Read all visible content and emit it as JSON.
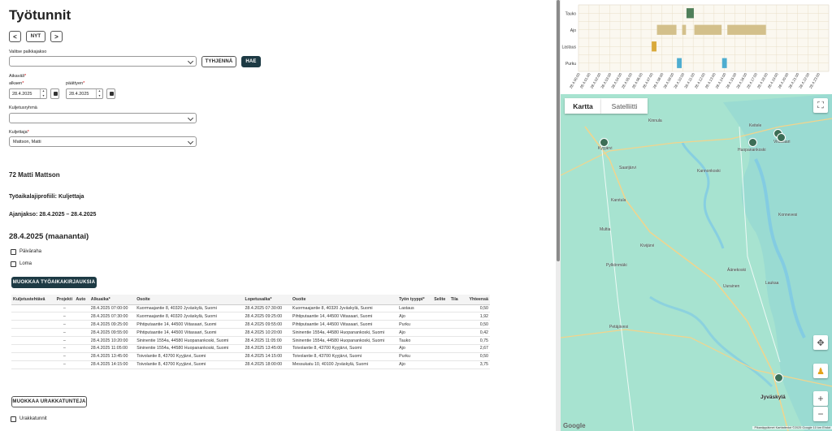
{
  "page": {
    "title": "Työtunnit",
    "prev_label": "<",
    "now_label": "NYT",
    "next_label": ">"
  },
  "filters": {
    "period_label": "Valitse palkkajakso",
    "period_value": "",
    "clear_label": "TYHJENNÄ",
    "fetch_label": "HAE",
    "range_label": "Aikaväli",
    "start_label": "alkaen",
    "start_value": "28.4.2025",
    "end_label": "päättyen",
    "end_value": "28.4.2025",
    "group_label": "Kuljetusryhmä",
    "group_value": "",
    "driver_label": "Kuljettaja",
    "driver_value": "Mattson, Matti",
    "required_mark": "*"
  },
  "summary": {
    "driver_heading": "72 Matti Mattson",
    "profile": "Työaikalajiprofiili: Kuljettaja",
    "period": "Ajanjakso: 28.4.2025 – 28.4.2025",
    "day_heading": "28.4.2025 (maanantai)",
    "allowance_label": "Päiväraha",
    "holiday_label": "Loma",
    "edit_log_label": "MUOKKAA TYÖAIKAKIRJAUKSIA",
    "edit_contracts_label": "MUOKKAA URAKKATUNTEJA",
    "contract_hours_label": "Urakkatunnit"
  },
  "table": {
    "headers": [
      "Kuljetustehtävä",
      "Projekti",
      "Auto",
      "Alkuaika*",
      "Osoite",
      "Lopetusaika*",
      "Osoite",
      "Työn tyyppi*",
      "Selite",
      "Tila",
      "Yhteensä"
    ],
    "rows": [
      [
        "",
        "–",
        "",
        "28.4.2025 07:00:00",
        "Kuormaajantie 8, 40320 Jyväskylä, Suomi",
        "28.4.2025 07:30:00",
        "Kuormaajantie 8, 40320 Jyväskylä, Suomi",
        "Lastaus",
        "",
        "",
        "0,50"
      ],
      [
        "",
        "–",
        "",
        "28.4.2025 07:30:00",
        "Kuormaajantie 8, 40320 Jyväskylä, Suomi",
        "28.4.2025 09:25:00",
        "Pihtiputaantie 14, 44500 Viitasaari, Suomi",
        "Ajo",
        "",
        "",
        "1,92"
      ],
      [
        "",
        "–",
        "",
        "28.4.2025 09:25:00",
        "Pihtiputaantie 14, 44500 Viitasaari, Suomi",
        "28.4.2025 09:55:00",
        "Pihtiputaantie 14, 44500 Viitasaari, Suomi",
        "Purku",
        "",
        "",
        "0,50"
      ],
      [
        "",
        "–",
        "",
        "28.4.2025 09:55:00",
        "Pihtiputaantie 14, 44500 Viitasaari, Suomi",
        "28.4.2025 10:20:00",
        "Sininentie 1554a, 44580 Huopanankoski, Suomi",
        "Ajo",
        "",
        "",
        "0,42"
      ],
      [
        "",
        "–",
        "",
        "28.4.2025 10:20:00",
        "Sininentie 1554a, 44580 Huopanankoski, Suomi",
        "28.4.2025 11:05:00",
        "Sininentie 1554a, 44580 Huopanankoski, Suomi",
        "Tauko",
        "",
        "",
        "0,75"
      ],
      [
        "",
        "–",
        "",
        "28.4.2025 11:05:00",
        "Sininentie 1554a, 44580 Huopanankoski, Suomi",
        "28.4.2025 13:45:00",
        "Toivolantie 8, 43700 Kyyjärvi, Suomi",
        "Ajo",
        "",
        "",
        "2,67"
      ],
      [
        "",
        "–",
        "",
        "28.4.2025 13:45:00",
        "Toivolantie 8, 43700 Kyyjärvi, Suomi",
        "28.4.2025 14:15:00",
        "Toivolantie 8, 43700 Kyyjärvi, Suomi",
        "Purku",
        "",
        "",
        "0,50"
      ],
      [
        "",
        "–",
        "",
        "28.4.2025 14:15:00",
        "Toivolantie 8, 43700 Kyyjärvi, Suomi",
        "28.4.2025 18:00:00",
        "Messukatu 10, 40100 Jyväskylä, Suomi",
        "Ajo",
        "",
        "",
        "3,75"
      ]
    ]
  },
  "chart_data": {
    "type": "timeline",
    "categories": [
      "Tauko",
      "Ajo",
      "Lastaus",
      "Purku"
    ],
    "x_ticks": [
      "28.4.00:00",
      "28.4.01:00",
      "28.4.02:00",
      "28.4.03:00",
      "28.4.04:00",
      "28.4.05:00",
      "28.4.06:00",
      "28.4.07:00",
      "28.4.08:00",
      "28.4.09:00",
      "28.4.10:00",
      "28.4.11:00",
      "28.4.12:00",
      "28.4.13:00",
      "28.4.14:00",
      "28.4.15:00",
      "28.4.16:00",
      "28.4.17:00",
      "28.4.18:00",
      "28.4.19:00",
      "28.4.20:00",
      "28.4.21:00",
      "28.4.22:00",
      "28.4.23:00"
    ],
    "xlim_hours": [
      0,
      24
    ],
    "grid": true,
    "colors": {
      "Tauko": "#4f7f5a",
      "Ajo": "#d3c08b",
      "Lastaus": "#d9a93a",
      "Purku": "#4eadd0"
    },
    "segments": [
      {
        "category": "Lastaus",
        "start": 7.0,
        "end": 7.5
      },
      {
        "category": "Ajo",
        "start": 7.5,
        "end": 9.417
      },
      {
        "category": "Purku",
        "start": 9.417,
        "end": 9.917
      },
      {
        "category": "Ajo",
        "start": 9.917,
        "end": 10.333
      },
      {
        "category": "Tauko",
        "start": 10.333,
        "end": 11.083
      },
      {
        "category": "Ajo",
        "start": 11.083,
        "end": 13.75
      },
      {
        "category": "Purku",
        "start": 13.75,
        "end": 14.25
      },
      {
        "category": "Ajo",
        "start": 14.25,
        "end": 18.0
      }
    ]
  },
  "map": {
    "tab_map": "Kartta",
    "tab_satellite": "Satelliitti",
    "places": [
      {
        "name": "Viitasaari",
        "big": false
      },
      {
        "name": "Huopanankoski",
        "big": false
      },
      {
        "name": "Kyyjärvi",
        "big": false
      },
      {
        "name": "Jyväskylä",
        "big": true
      },
      {
        "name": "Kivijärvi",
        "big": false
      },
      {
        "name": "Keitele",
        "big": false
      },
      {
        "name": "Saarijärvi",
        "big": false
      },
      {
        "name": "Karstula",
        "big": false
      },
      {
        "name": "Kannonkoski",
        "big": false
      },
      {
        "name": "Pylkönmäki",
        "big": false
      },
      {
        "name": "Uurainen",
        "big": false
      },
      {
        "name": "Laukaa",
        "big": false
      },
      {
        "name": "Konnevesi",
        "big": false
      },
      {
        "name": "Petäjävesi",
        "big": false
      },
      {
        "name": "Multia",
        "big": false
      },
      {
        "name": "Äänekoski",
        "big": false
      },
      {
        "name": "Kinnula",
        "big": false
      }
    ],
    "footer": "Pikanäppäimet  Karttatiedot ©2025 Google  10 km  Ehdot",
    "google": "Google"
  }
}
